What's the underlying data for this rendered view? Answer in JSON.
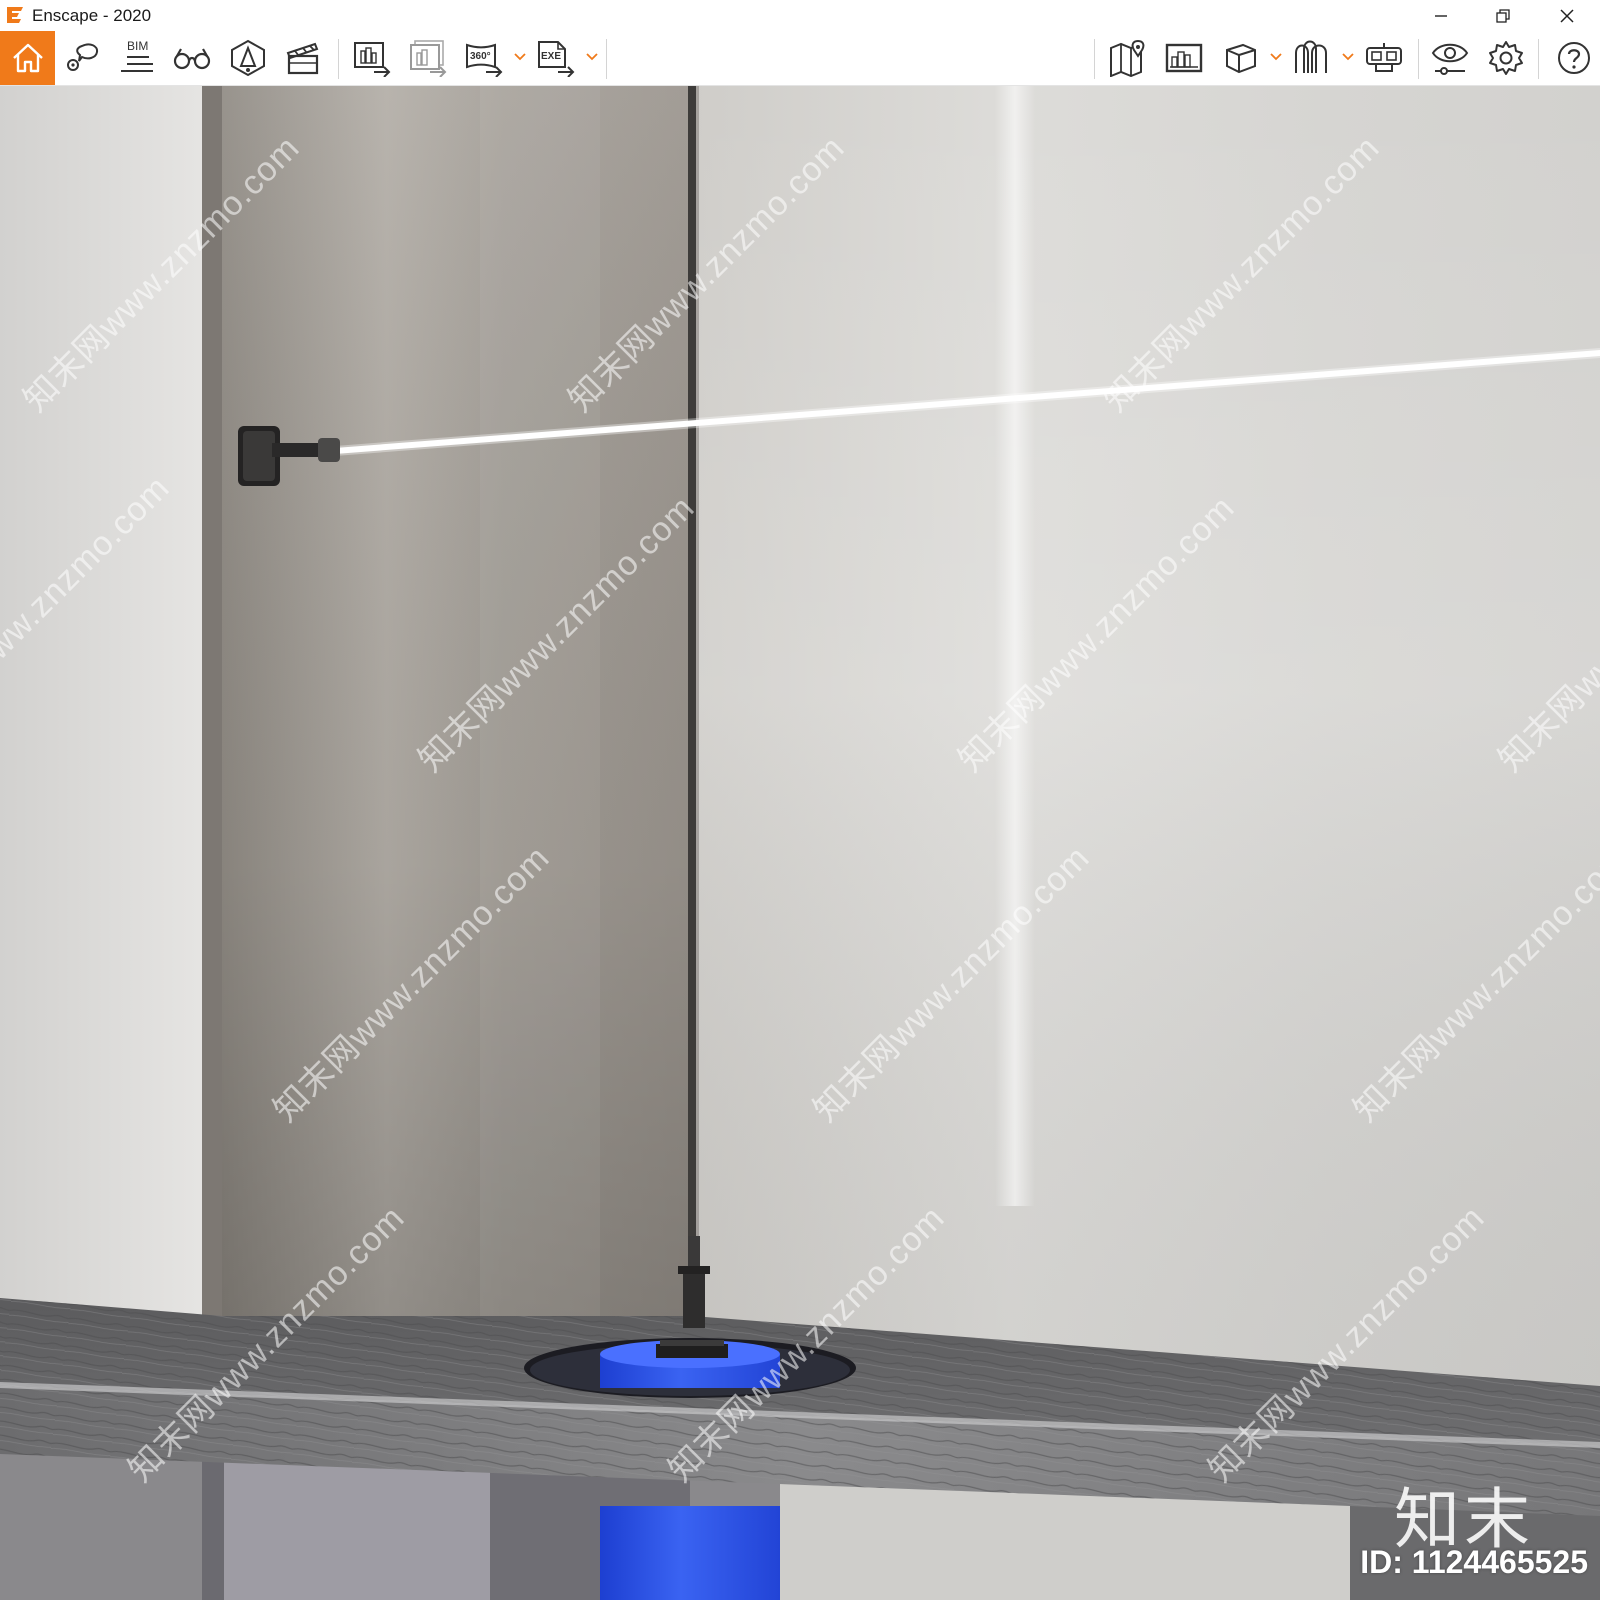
{
  "window": {
    "title": "Enscape - 2020",
    "accent_color": "#f07a1a"
  },
  "titlebar_controls": [
    {
      "name": "minimize",
      "icon": "minimize-icon"
    },
    {
      "name": "restore",
      "icon": "restore-icon"
    },
    {
      "name": "close",
      "icon": "close-icon"
    }
  ],
  "toolbar": {
    "home_icon": "home-icon",
    "bim_label": "BIM",
    "view_360_label": "360°",
    "exe_label": "EXE",
    "left_tools": [
      "home-icon",
      "views-icon",
      "bim-icon",
      "binoculars-icon",
      "light-view-icon",
      "video-editor-icon",
      "screenshot-export-icon",
      "batch-render-icon",
      "panorama-360-icon",
      "exe-export-icon"
    ],
    "right_tools": [
      "map-icon",
      "minimap-icon",
      "asset-library-icon",
      "materials-icon",
      "vr-headset-icon",
      "visual-settings-icon",
      "settings-icon",
      "help-icon"
    ]
  },
  "viewport": {
    "watermark_text": "知末网www.znzmo.com",
    "brand_text": "知末",
    "id_text": "ID: 1124465525"
  }
}
